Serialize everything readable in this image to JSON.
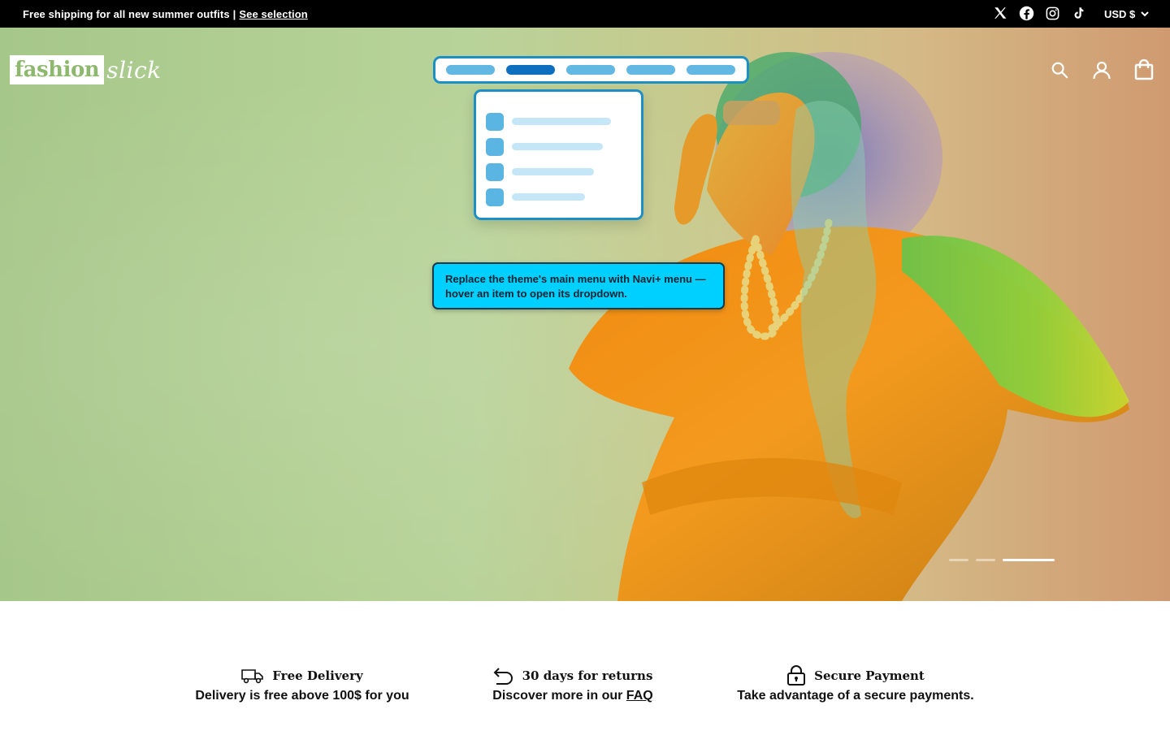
{
  "announcement": {
    "text": "Free shipping for all new summer outfits",
    "separator": "|",
    "link": "See selection"
  },
  "socials": [
    "x-icon",
    "facebook-icon",
    "instagram-icon",
    "tiktok-icon"
  ],
  "currency": {
    "label": "USD $"
  },
  "logo": {
    "word": "fashion",
    "script": "slick"
  },
  "header_icons": [
    "search-icon",
    "account-icon",
    "bag-icon"
  ],
  "navi_mock": {
    "items": 5,
    "active_index": 1,
    "dropdown_rows": 4
  },
  "tooltip": {
    "text": "Replace the theme's main menu with Navi+ menu — hover an item to open its dropdown."
  },
  "slider": {
    "count": 3,
    "active_index": 2
  },
  "features": [
    {
      "icon": "truck-icon",
      "title": "Free Delivery",
      "desc": "Delivery is free above 100$ for you",
      "link": ""
    },
    {
      "icon": "return-arrow-icon",
      "title": "30 days for returns",
      "desc": "Discover more in our ",
      "link": "FAQ"
    },
    {
      "icon": "lock-icon",
      "title": "Secure Payment",
      "desc": "Take advantage of a secure payments.",
      "link": ""
    }
  ],
  "colors": {
    "topbar": "#000000",
    "hero_green": "#b3d094",
    "navi_border": "#1d8fc4",
    "navi_active": "#0f6fbf",
    "navi_pill": "#62b7e3",
    "tooltip_bg": "#00d0ff"
  }
}
